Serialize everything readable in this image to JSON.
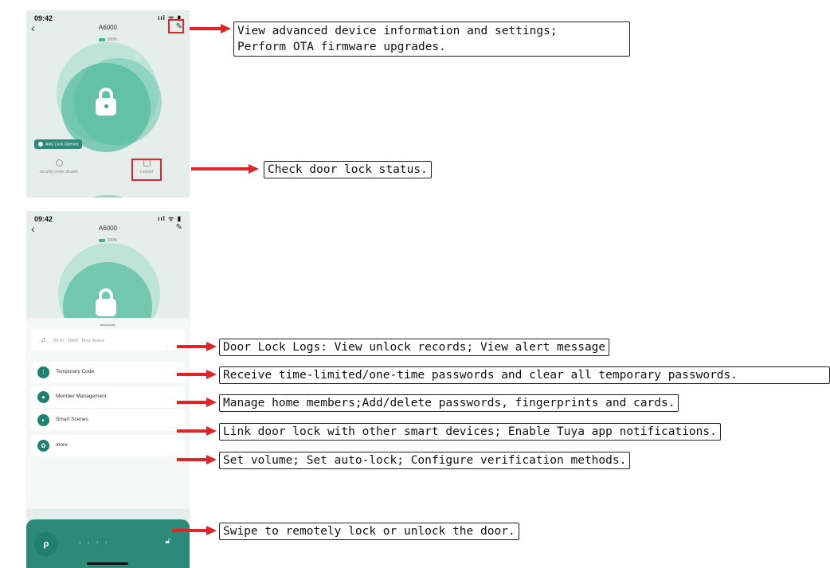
{
  "phone_top": {
    "status_time": "09:42",
    "status_icons": "ııl ᯤ ▮",
    "device_title": "A6000",
    "battery_text": "100%",
    "auto_lock_badge": "Auto Lock Opened",
    "status_left_label": "security mode disable",
    "status_right_label": "Locked"
  },
  "phone_bottom": {
    "status_time": "09:42",
    "status_icons": "ııl ᯤ ▮",
    "device_title": "A6000",
    "battery_text": "100%",
    "menu": {
      "log_entry": "09:42 【Me】 Bind device",
      "items": [
        "Temporary Code",
        "Member Management",
        "Smart Scenes",
        "more"
      ]
    }
  },
  "callouts": {
    "edit": "View advanced device information and settings;\nPerform OTA firmware upgrades.",
    "status": "Check door lock status.",
    "logs": "Door Lock Logs: View unlock records; View alert message ",
    "temp_code": "Receive time-limited/one-time passwords and clear all temporary passwords.",
    "members": "Manage home members;Add/delete passwords, fingerprints and cards.",
    "scenes": "Link door lock with other smart devices; Enable Tuya app notifications.",
    "more": "Set volume; Set auto-lock; Configure verification methods.",
    "swipe": "Swipe to remotely lock or unlock the door."
  },
  "colors": {
    "accent": "#2c8a78",
    "arrow": "#e0252a",
    "screen_bg": "#e6eeeb"
  }
}
